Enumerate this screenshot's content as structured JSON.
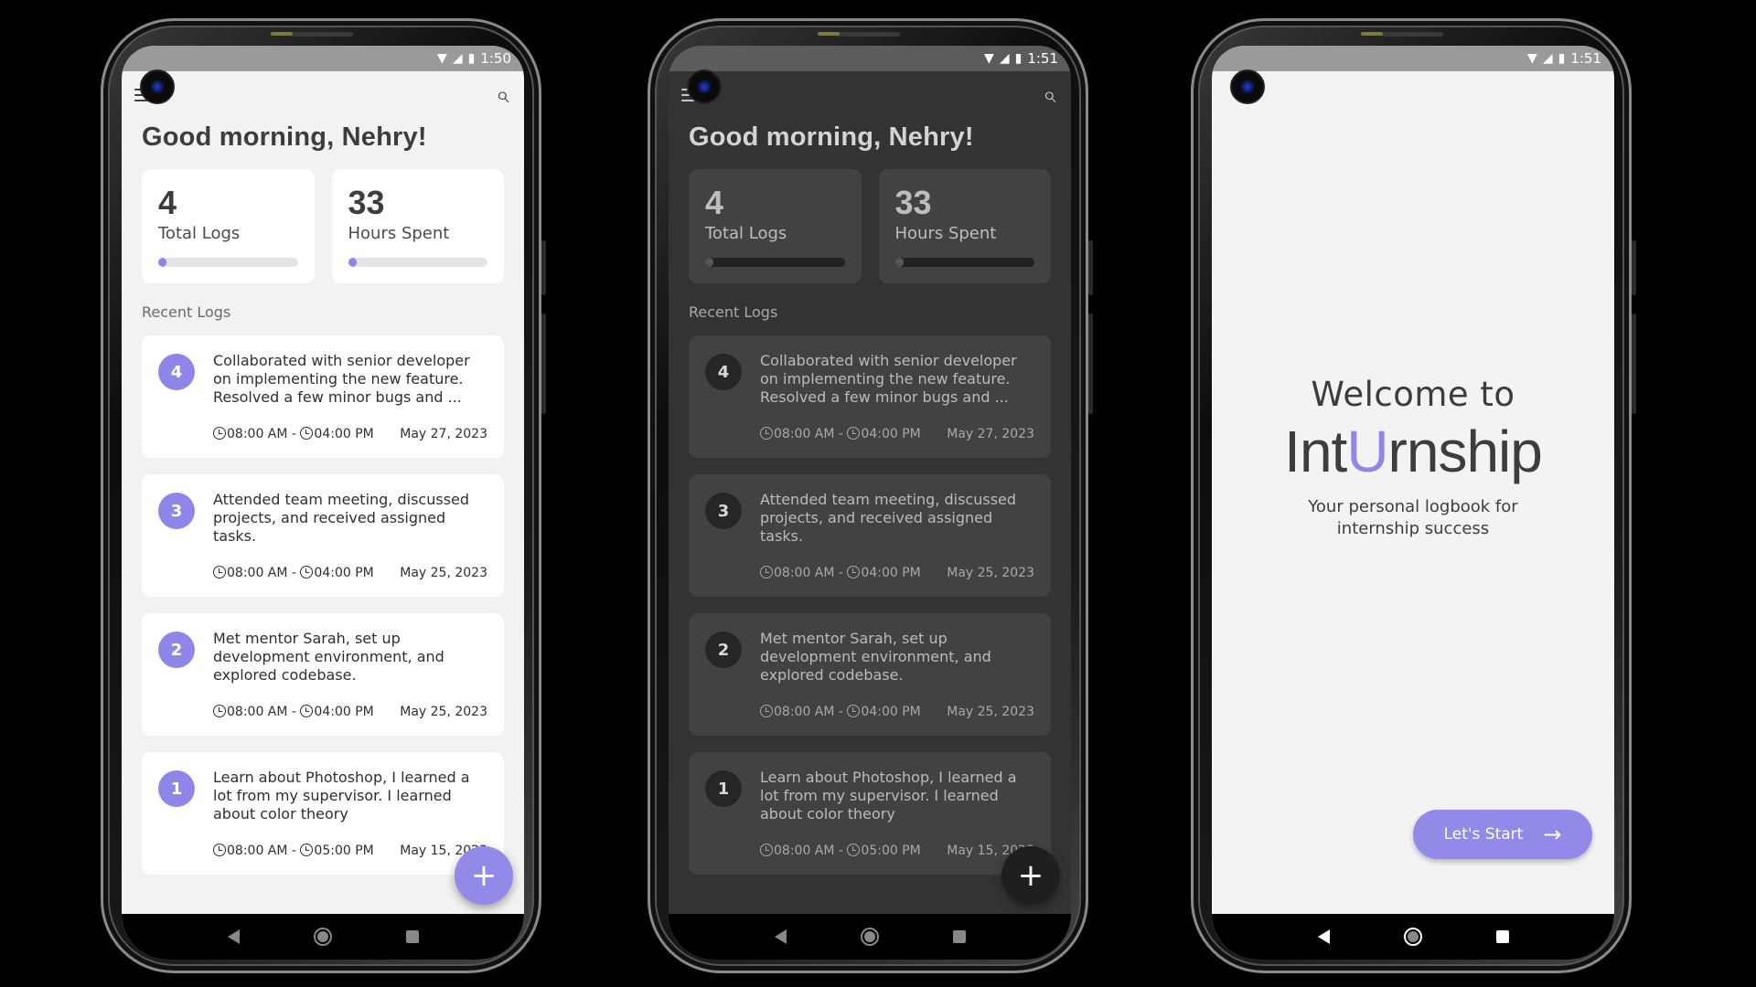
{
  "status": {
    "phone1_time": "1:50",
    "phone2_time": "1:51",
    "phone3_time": "1:51"
  },
  "icons": {
    "wifi": "▼",
    "signal": "◢",
    "battery": "▮",
    "search": "⌕",
    "plus": "+",
    "arrow": "→"
  },
  "home": {
    "greeting": "Good morning, Nehry!",
    "stats": [
      {
        "value": "4",
        "label": "Total Logs",
        "progress": 0.06
      },
      {
        "value": "33",
        "label": "Hours Spent",
        "progress": 0.06
      }
    ],
    "section_title": "Recent Logs",
    "logs": [
      {
        "number": "4",
        "text": "Collaborated with senior developer on implementing the new feature. Resolved a few minor bugs and ...",
        "start": "08:00 AM",
        "end": "04:00 PM",
        "date": "May 27, 2023"
      },
      {
        "number": "3",
        "text": "Attended team meeting, discussed projects, and received assigned tasks.",
        "start": "08:00 AM",
        "end": "04:00 PM",
        "date": "May 25, 2023"
      },
      {
        "number": "2",
        "text": "Met mentor Sarah, set up development environment, and explored codebase.",
        "start": "08:00 AM",
        "end": "04:00 PM",
        "date": "May 25, 2023"
      },
      {
        "number": "1",
        "text": "Learn about Photoshop, I learned a lot from my supervisor. I learned about color theory",
        "start": "08:00 AM",
        "end": "05:00 PM",
        "date": "May 15, 2023"
      }
    ]
  },
  "welcome": {
    "line1": "Welcome to",
    "brand_prefix": "Int",
    "brand_accent": "U",
    "brand_suffix": "rnship",
    "tagline_line1": "Your personal logbook for",
    "tagline_line2": "internship success",
    "start_label": "Let's Start"
  },
  "colors": {
    "accent": "#8e86e8",
    "light_bg": "#f2f2f2",
    "dark_bg": "#333333"
  }
}
